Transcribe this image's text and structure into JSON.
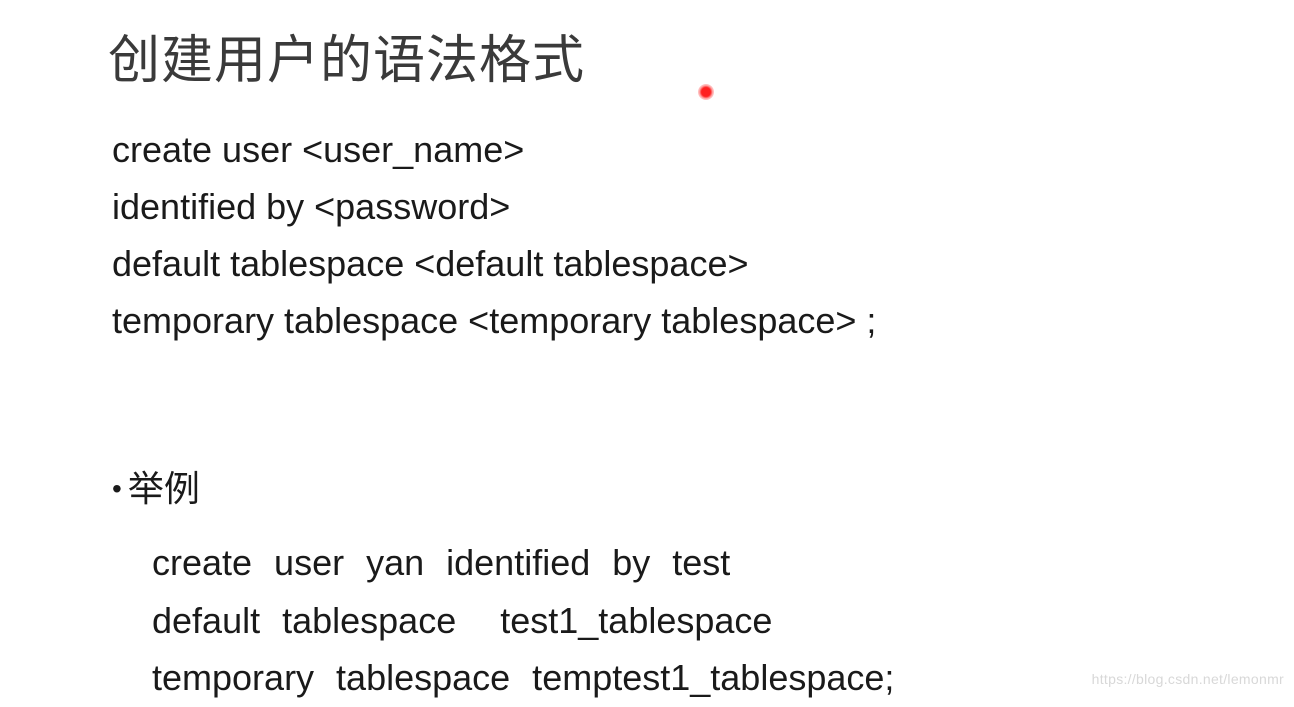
{
  "title": "创建用户的语法格式",
  "syntax": {
    "line1": "create user <user_name>",
    "line2": "identified by <password>",
    "line3": "default tablespace <default tablespace>",
    "line4": "temporary tablespace <temporary tablespace> ;"
  },
  "example": {
    "bullet_label": "举例",
    "line1": "create user yan identified by test",
    "line2": "default tablespace  test1_tablespace",
    "line3": "temporary tablespace temptest1_tablespace;"
  },
  "watermark": "https://blog.csdn.net/lemonmr"
}
